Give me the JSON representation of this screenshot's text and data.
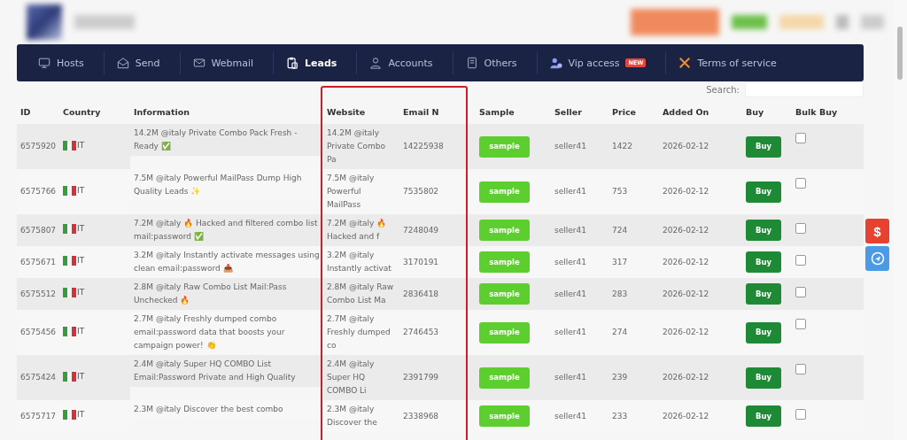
{
  "nav": [
    {
      "label": "Hosts",
      "selected": false
    },
    {
      "label": "Send",
      "selected": false
    },
    {
      "label": "Webmail",
      "selected": false
    },
    {
      "label": "Leads",
      "selected": true
    },
    {
      "label": "Accounts",
      "selected": false
    },
    {
      "label": "Others",
      "selected": false
    },
    {
      "label": "Vip access",
      "selected": false,
      "badge": "NEW"
    },
    {
      "label": "Terms of service",
      "selected": false
    }
  ],
  "search": {
    "label": "Search:"
  },
  "table": {
    "columns": [
      "ID",
      "Country",
      "Information",
      "Website",
      "Email N",
      "Sample",
      "Seller",
      "Price",
      "Added On",
      "Buy",
      "Bulk Buy"
    ],
    "rows": [
      {
        "id": "6575920",
        "country": "IT",
        "info": "14.2M @italy Private Combo Pack Fresh - Ready ✅",
        "website": "14.2M @italy Private Combo Pa",
        "email_n": "14225938",
        "sample": "sample",
        "seller": "seller41",
        "price": "1422",
        "added_on": "2026-02-12",
        "buy": "Buy",
        "checked": false
      },
      {
        "id": "6575766",
        "country": "IT",
        "info": "7.5M @italy Powerful MailPass Dump High Quality Leads ✨",
        "website": "7.5M @italy Powerful MailPass",
        "email_n": "7535802",
        "sample": "sample",
        "seller": "seller41",
        "price": "753",
        "added_on": "2026-02-12",
        "buy": "Buy",
        "checked": false
      },
      {
        "id": "6575807",
        "country": "IT",
        "info": "7.2M @italy 🔥 Hacked and filtered combo list mail:password ✅",
        "website": "7.2M @italy 🔥 Hacked and f",
        "email_n": "7248049",
        "sample": "sample",
        "seller": "seller41",
        "price": "724",
        "added_on": "2026-02-12",
        "buy": "Buy",
        "checked": false
      },
      {
        "id": "6575671",
        "country": "IT",
        "info": "3.2M @italy Instantly activate messages using clean email:password 📥",
        "website": "3.2M @italy Instantly activat",
        "email_n": "3170191",
        "sample": "sample",
        "seller": "seller41",
        "price": "317",
        "added_on": "2026-02-12",
        "buy": "Buy",
        "checked": false
      },
      {
        "id": "6575512",
        "country": "IT",
        "info": "2.8M @italy Raw Combo List Mail:Pass Unchecked 🔥",
        "website": "2.8M @italy Raw Combo List Ma",
        "email_n": "2836418",
        "sample": "sample",
        "seller": "seller41",
        "price": "283",
        "added_on": "2026-02-12",
        "buy": "Buy",
        "checked": false
      },
      {
        "id": "6575456",
        "country": "IT",
        "info": "2.7M @italy Freshly dumped combo email:password data that boosts your campaign power! 👏",
        "website": "2.7M @italy Freshly dumped co",
        "email_n": "2746453",
        "sample": "sample",
        "seller": "seller41",
        "price": "274",
        "added_on": "2026-02-12",
        "buy": "Buy",
        "checked": false
      },
      {
        "id": "6575424",
        "country": "IT",
        "info": "2.4M @italy Super HQ COMBO List Email:Password Private and High Quality",
        "website": "2.4M @italy Super HQ COMBO Li",
        "email_n": "2391799",
        "sample": "sample",
        "seller": "seller41",
        "price": "239",
        "added_on": "2026-02-12",
        "buy": "Buy",
        "checked": false
      },
      {
        "id": "6575717",
        "country": "IT",
        "info": "2.3M @italy Discover the best combo",
        "website": "2.3M @italy Discover the",
        "email_n": "2338968",
        "sample": "sample",
        "seller": "seller41",
        "price": "233",
        "added_on": "2026-02-12",
        "buy": "Buy",
        "checked": false
      }
    ]
  },
  "side_buttons": [
    {
      "kind": "dollar",
      "label": "$"
    },
    {
      "kind": "telegram"
    }
  ]
}
